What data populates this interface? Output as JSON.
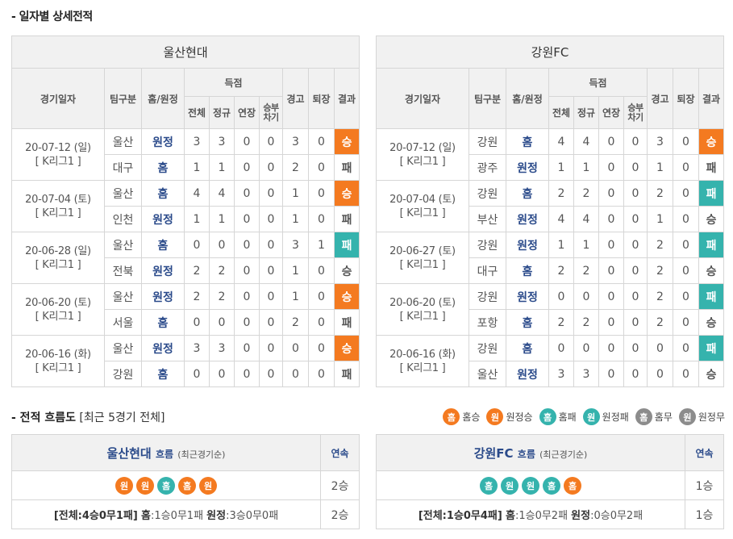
{
  "section_title": "- 일자별 상세전적",
  "headers": {
    "date": "경기일자",
    "team": "팀구분",
    "venue": "홈/원정",
    "score": "득점",
    "total": "전체",
    "regular": "정규",
    "extra": "연장",
    "pk": "승부차기",
    "warn": "경고",
    "sent": "퇴장",
    "result": "결과"
  },
  "left": {
    "team_name": "울산현대",
    "matches": [
      {
        "date": "20-07-12 (일)",
        "league": "[ K리그1 ]",
        "rows": [
          {
            "team": "울산",
            "venue": "원정",
            "total": "3",
            "regular": "3",
            "extra": "0",
            "pk": "0",
            "warn": "3",
            "sent": "0",
            "result": "승",
            "rtype": "win"
          },
          {
            "team": "대구",
            "venue": "홈",
            "total": "1",
            "regular": "1",
            "extra": "0",
            "pk": "0",
            "warn": "2",
            "sent": "0",
            "result": "패",
            "rtype": "draw"
          }
        ]
      },
      {
        "date": "20-07-04 (토)",
        "league": "[ K리그1 ]",
        "rows": [
          {
            "team": "울산",
            "venue": "홈",
            "total": "4",
            "regular": "4",
            "extra": "0",
            "pk": "0",
            "warn": "1",
            "sent": "0",
            "result": "승",
            "rtype": "win"
          },
          {
            "team": "인천",
            "venue": "원정",
            "total": "1",
            "regular": "1",
            "extra": "0",
            "pk": "0",
            "warn": "1",
            "sent": "0",
            "result": "패",
            "rtype": "draw"
          }
        ]
      },
      {
        "date": "20-06-28 (일)",
        "league": "[ K리그1 ]",
        "rows": [
          {
            "team": "울산",
            "venue": "홈",
            "total": "0",
            "regular": "0",
            "extra": "0",
            "pk": "0",
            "warn": "3",
            "sent": "1",
            "result": "패",
            "rtype": "loss"
          },
          {
            "team": "전북",
            "venue": "원정",
            "total": "2",
            "regular": "2",
            "extra": "0",
            "pk": "0",
            "warn": "1",
            "sent": "0",
            "result": "승",
            "rtype": "draw"
          }
        ]
      },
      {
        "date": "20-06-20 (토)",
        "league": "[ K리그1 ]",
        "rows": [
          {
            "team": "울산",
            "venue": "원정",
            "total": "2",
            "regular": "2",
            "extra": "0",
            "pk": "0",
            "warn": "1",
            "sent": "0",
            "result": "승",
            "rtype": "win"
          },
          {
            "team": "서울",
            "venue": "홈",
            "total": "0",
            "regular": "0",
            "extra": "0",
            "pk": "0",
            "warn": "2",
            "sent": "0",
            "result": "패",
            "rtype": "draw"
          }
        ]
      },
      {
        "date": "20-06-16 (화)",
        "league": "[ K리그1 ]",
        "rows": [
          {
            "team": "울산",
            "venue": "원정",
            "total": "3",
            "regular": "3",
            "extra": "0",
            "pk": "0",
            "warn": "0",
            "sent": "0",
            "result": "승",
            "rtype": "win"
          },
          {
            "team": "강원",
            "venue": "홈",
            "total": "0",
            "regular": "0",
            "extra": "0",
            "pk": "0",
            "warn": "0",
            "sent": "0",
            "result": "패",
            "rtype": "draw"
          }
        ]
      }
    ]
  },
  "right": {
    "team_name": "강원FC",
    "matches": [
      {
        "date": "20-07-12 (일)",
        "league": "[ K리그1 ]",
        "rows": [
          {
            "team": "강원",
            "venue": "홈",
            "total": "4",
            "regular": "4",
            "extra": "0",
            "pk": "0",
            "warn": "3",
            "sent": "0",
            "result": "승",
            "rtype": "win"
          },
          {
            "team": "광주",
            "venue": "원정",
            "total": "1",
            "regular": "1",
            "extra": "0",
            "pk": "0",
            "warn": "1",
            "sent": "0",
            "result": "패",
            "rtype": "draw"
          }
        ]
      },
      {
        "date": "20-07-04 (토)",
        "league": "[ K리그1 ]",
        "rows": [
          {
            "team": "강원",
            "venue": "홈",
            "total": "2",
            "regular": "2",
            "extra": "0",
            "pk": "0",
            "warn": "2",
            "sent": "0",
            "result": "패",
            "rtype": "loss"
          },
          {
            "team": "부산",
            "venue": "원정",
            "total": "4",
            "regular": "4",
            "extra": "0",
            "pk": "0",
            "warn": "1",
            "sent": "0",
            "result": "승",
            "rtype": "draw"
          }
        ]
      },
      {
        "date": "20-06-27 (토)",
        "league": "[ K리그1 ]",
        "rows": [
          {
            "team": "강원",
            "venue": "원정",
            "total": "1",
            "regular": "1",
            "extra": "0",
            "pk": "0",
            "warn": "2",
            "sent": "0",
            "result": "패",
            "rtype": "loss"
          },
          {
            "team": "대구",
            "venue": "홈",
            "total": "2",
            "regular": "2",
            "extra": "0",
            "pk": "0",
            "warn": "2",
            "sent": "0",
            "result": "승",
            "rtype": "draw"
          }
        ]
      },
      {
        "date": "20-06-20 (토)",
        "league": "[ K리그1 ]",
        "rows": [
          {
            "team": "강원",
            "venue": "원정",
            "total": "0",
            "regular": "0",
            "extra": "0",
            "pk": "0",
            "warn": "2",
            "sent": "0",
            "result": "패",
            "rtype": "loss"
          },
          {
            "team": "포항",
            "venue": "홈",
            "total": "2",
            "regular": "2",
            "extra": "0",
            "pk": "0",
            "warn": "2",
            "sent": "0",
            "result": "승",
            "rtype": "draw"
          }
        ]
      },
      {
        "date": "20-06-16 (화)",
        "league": "[ K리그1 ]",
        "rows": [
          {
            "team": "강원",
            "venue": "홈",
            "total": "0",
            "regular": "0",
            "extra": "0",
            "pk": "0",
            "warn": "0",
            "sent": "0",
            "result": "패",
            "rtype": "loss"
          },
          {
            "team": "울산",
            "venue": "원정",
            "total": "3",
            "regular": "3",
            "extra": "0",
            "pk": "0",
            "warn": "0",
            "sent": "0",
            "result": "승",
            "rtype": "draw"
          }
        ]
      }
    ]
  },
  "flow": {
    "title": "- 전적 흐름도",
    "subtitle": "[최근 5경기 전체]",
    "legend": [
      {
        "glyph": "홈",
        "label": "홈승",
        "color": "o"
      },
      {
        "glyph": "원",
        "label": "원정승",
        "color": "o"
      },
      {
        "glyph": "홈",
        "label": "홈패",
        "color": "t"
      },
      {
        "glyph": "원",
        "label": "원정패",
        "color": "t"
      },
      {
        "glyph": "홈",
        "label": "홈무",
        "color": "g"
      },
      {
        "glyph": "원",
        "label": "원정무",
        "color": "g"
      }
    ],
    "flow_word": "흐름",
    "order_note": "(최근경기순)",
    "streak_header": "연속",
    "left": {
      "team_name": "울산현대",
      "circles": [
        {
          "glyph": "원",
          "color": "o"
        },
        {
          "glyph": "원",
          "color": "o"
        },
        {
          "glyph": "홈",
          "color": "t"
        },
        {
          "glyph": "홈",
          "color": "o"
        },
        {
          "glyph": "원",
          "color": "o"
        }
      ],
      "streak": "2승",
      "summary_total": "[전체:4승0무1패]",
      "summary_home_label": "홈",
      "summary_home": ":1승0무1패",
      "summary_away_label": "원정",
      "summary_away": ":3승0무0패",
      "streak2": "2승"
    },
    "right": {
      "team_name": "강원FC",
      "circles": [
        {
          "glyph": "홈",
          "color": "t"
        },
        {
          "glyph": "원",
          "color": "t"
        },
        {
          "glyph": "원",
          "color": "t"
        },
        {
          "glyph": "홈",
          "color": "t"
        },
        {
          "glyph": "홈",
          "color": "o"
        }
      ],
      "streak": "1승",
      "summary_total": "[전체:1승0무4패]",
      "summary_home_label": "홈",
      "summary_home": ":1승0무2패",
      "summary_away_label": "원정",
      "summary_away": ":0승0무2패",
      "streak2": "1승"
    }
  }
}
